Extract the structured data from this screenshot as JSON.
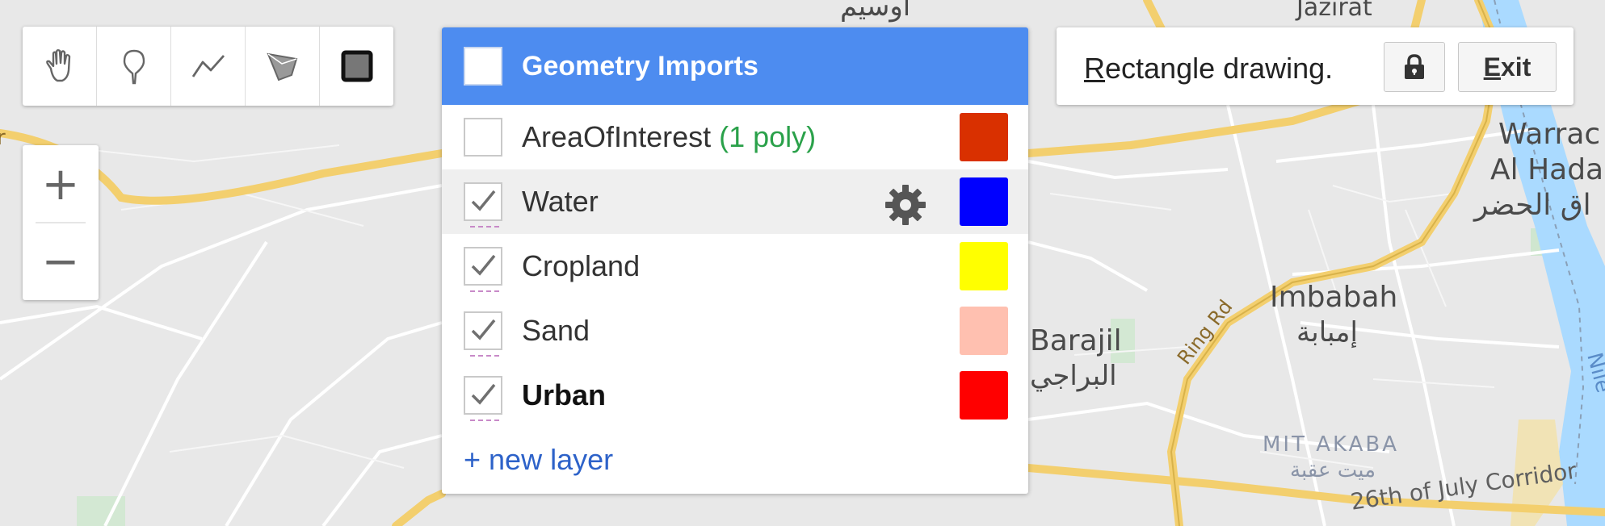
{
  "map": {
    "labels": {
      "awsim": "أوسيم",
      "jazirat": "Jazirat",
      "warraq": "Warrac",
      "al_hada": "Al Hada",
      "al_hadar_ar": "اق الحضر",
      "imbabah": "Imbabah",
      "imbabah_ar": "إمبابة",
      "barajil": "Barajil",
      "barajil_ar": "البراجي",
      "ring_rd": "Ring Rd",
      "mit_akaba": "MIT AKABA",
      "mit_akaba_ar": "ميت عقبة",
      "july_corridor": "26th of July Corridor",
      "nile": "Nile",
      "left_edge": "r"
    }
  },
  "toolbar": {
    "tools": [
      {
        "icon": "hand-icon"
      },
      {
        "icon": "marker-icon"
      },
      {
        "icon": "line-icon"
      },
      {
        "icon": "polygon-icon"
      },
      {
        "icon": "rectangle-icon"
      }
    ]
  },
  "zoom": {
    "in_label": "+",
    "out_label": "−"
  },
  "geometry_panel": {
    "title": "Geometry Imports",
    "layers": [
      {
        "name": "AreaOfInterest",
        "count": "(1 poly)",
        "checked": false,
        "color": "#d93000"
      },
      {
        "name": "Water",
        "checked": true,
        "color": "#0000ff"
      },
      {
        "name": "Cropland",
        "checked": true,
        "color": "#ffff00"
      },
      {
        "name": "Sand",
        "checked": true,
        "color": "#ffc0b0"
      },
      {
        "name": "Urban",
        "checked": true,
        "color": "#ff0000"
      }
    ],
    "new_layer": "+ new layer"
  },
  "drawing_mode": {
    "text_first": "R",
    "text_rest": "ectangle drawing.",
    "lock_icon": "lock-icon",
    "exit_first": "E",
    "exit_rest": "xit"
  }
}
